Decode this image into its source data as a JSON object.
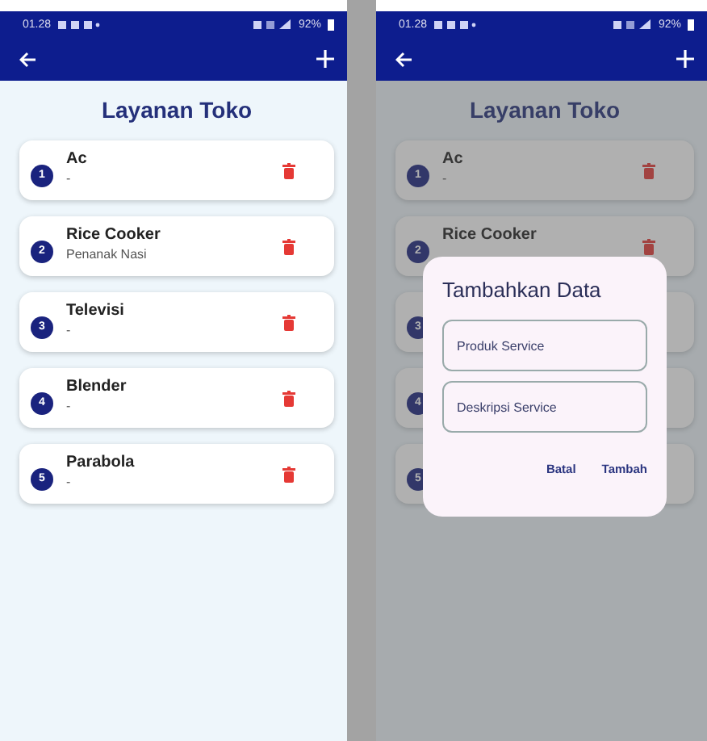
{
  "screens": [
    {
      "status_bar": {
        "time": "01.28",
        "battery": "92%"
      },
      "title": "Layanan Toko",
      "items": [
        {
          "number": "1",
          "name": "Ac",
          "description": "-"
        },
        {
          "number": "2",
          "name": "Rice Cooker",
          "description": "Penanak Nasi"
        },
        {
          "number": "3",
          "name": "Televisi",
          "description": "-"
        },
        {
          "number": "4",
          "name": "Blender",
          "description": "-"
        },
        {
          "number": "5",
          "name": "Parabola",
          "description": "-"
        }
      ]
    },
    {
      "status_bar": {
        "time": "01.28",
        "battery": "92%"
      },
      "title": "Layanan Toko",
      "items": [
        {
          "number": "1",
          "name": "Ac",
          "description": "-"
        },
        {
          "number": "2",
          "name": "Rice Cooker"
        },
        {
          "number": "3"
        },
        {
          "number": "4"
        },
        {
          "number": "5"
        }
      ],
      "dialog": {
        "title": "Tambahkan Data",
        "fields": [
          {
            "placeholder": "Produk Service"
          },
          {
            "placeholder": "Deskripsi Service"
          }
        ],
        "buttons": [
          "Batal",
          "Tambah"
        ]
      }
    }
  ]
}
